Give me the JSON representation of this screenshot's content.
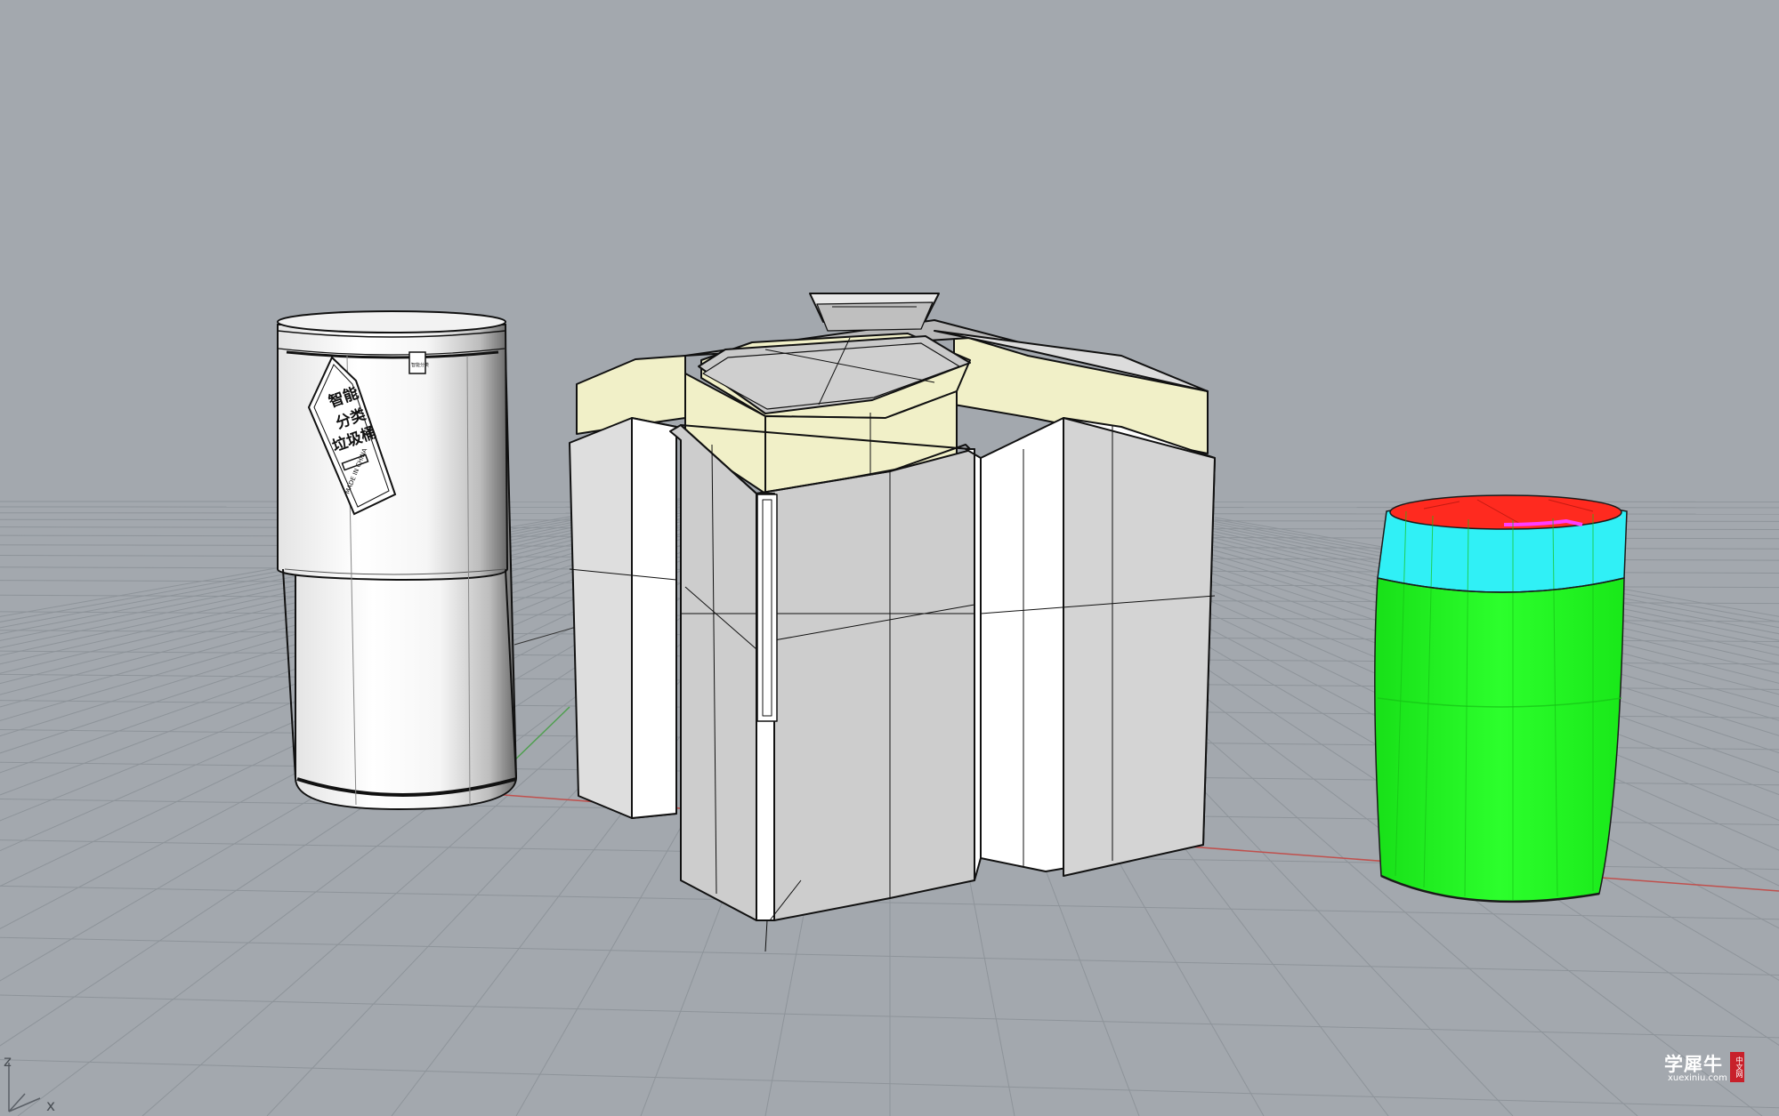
{
  "viewport": {
    "background": "#a3a8ae",
    "grid_color": "#8e949a",
    "axis_x_color": "#c0504d",
    "axis_y_color": "#4f9f4f",
    "axis_labels": {
      "z": "z",
      "x": "x"
    }
  },
  "objects": {
    "left_bin": {
      "label_line1": "智能",
      "label_line2": "分类",
      "label_line3": "垃圾桶",
      "made_in": "MADE IN CHINA",
      "badge": "智能分类"
    },
    "center_bin": {
      "color_fill": "#cdcdcd",
      "band_color": "#f1f0c8"
    },
    "right_bin": {
      "lid_color": "#ff2a1f",
      "band_color": "#30f0f6",
      "body_color": "#1ff81f"
    }
  },
  "watermark": {
    "main": "学犀牛",
    "url": "xuexiniu.com",
    "seal": "中文网"
  }
}
